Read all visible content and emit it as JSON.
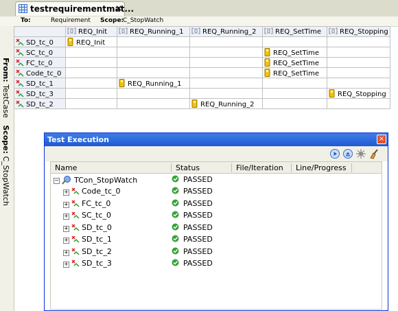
{
  "editor": {
    "tab_title": "testrequirementmat...",
    "close_glyph": "×",
    "to_label": "To:",
    "to_value": "Requirement",
    "scope_label": "Scope:",
    "scope_value": "C_StopWatch",
    "vertical_from_label": "From:",
    "vertical_from_value": "TestCase",
    "vertical_scope_label": "Scope:",
    "vertical_scope_value": "C_StopWatch"
  },
  "matrix": {
    "columns": [
      "REQ_Init",
      "REQ_Running_1",
      "REQ_Running_2",
      "REQ_SetTime",
      "REQ_Stopping"
    ],
    "rows": [
      {
        "name": "SD_tc_0",
        "cells": [
          "REQ_Init",
          "",
          "",
          "",
          ""
        ]
      },
      {
        "name": "SC_tc_0",
        "cells": [
          "",
          "",
          "",
          "REQ_SetTime",
          ""
        ]
      },
      {
        "name": "FC_tc_0",
        "cells": [
          "",
          "",
          "",
          "REQ_SetTime",
          ""
        ]
      },
      {
        "name": "Code_tc_0",
        "cells": [
          "",
          "",
          "",
          "REQ_SetTime",
          ""
        ]
      },
      {
        "name": "SD_tc_1",
        "cells": [
          "",
          "REQ_Running_1",
          "",
          "",
          ""
        ]
      },
      {
        "name": "SD_tc_3",
        "cells": [
          "",
          "",
          "",
          "",
          "REQ_Stopping"
        ]
      },
      {
        "name": "SD_tc_2",
        "cells": [
          "",
          "",
          "REQ_Running_2",
          "",
          ""
        ]
      }
    ]
  },
  "dialog": {
    "title": "Test Execution",
    "close_glyph": "×",
    "toolbar_icons": [
      "run-icon",
      "stop-icon",
      "debug-icon",
      "clear-icon"
    ],
    "columns": [
      "Name",
      "Status",
      "File/Iteration",
      "Line/Progress"
    ],
    "root": {
      "name": "TCon_StopWatch",
      "status": "PASSED",
      "expander": "−"
    },
    "children": [
      {
        "name": "Code_tc_0",
        "status": "PASSED",
        "expander": "+"
      },
      {
        "name": "FC_tc_0",
        "status": "PASSED",
        "expander": "+"
      },
      {
        "name": "SC_tc_0",
        "status": "PASSED",
        "expander": "+"
      },
      {
        "name": "SD_tc_0",
        "status": "PASSED",
        "expander": "+"
      },
      {
        "name": "SD_tc_1",
        "status": "PASSED",
        "expander": "+"
      },
      {
        "name": "SD_tc_2",
        "status": "PASSED",
        "expander": "+"
      },
      {
        "name": "SD_tc_3",
        "status": "PASSED",
        "expander": "+"
      }
    ]
  },
  "colors": {
    "title_bar": "#2a63d8",
    "pass_green": "#3a9a3a",
    "requirement_yellow": "#e8b400"
  }
}
